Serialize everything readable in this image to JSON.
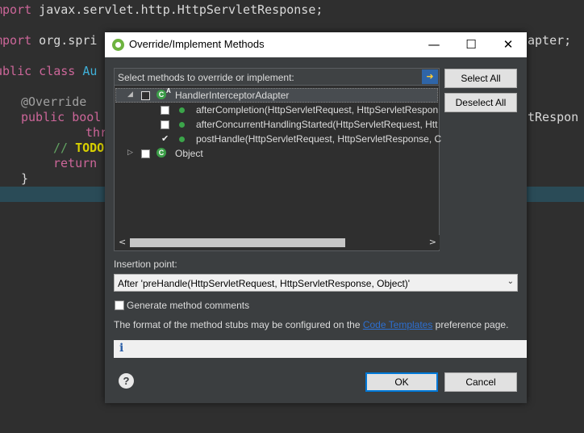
{
  "editor": {
    "lines": [
      {
        "a": "mport",
        "b": " javax.servlet.http.HttpServletResponse;"
      },
      {
        "a": "mport",
        "b": " org.spri"
      },
      {
        "a": "ublic class ",
        "b": "Au"
      },
      {
        "a": "@Override",
        "b": ""
      },
      {
        "a": "public bool",
        "b": ""
      },
      {
        "a": "thr",
        "b": ""
      },
      {
        "a": "// ",
        "b": "TODO"
      },
      {
        "a": "return ",
        "b": ""
      },
      {
        "a": "}",
        "b": ""
      }
    ],
    "right_fragments": [
      "apter;",
      "tRespon"
    ]
  },
  "dialog": {
    "title": "Override/Implement Methods",
    "window_buttons": {
      "minimize": "—",
      "maximize": "☐",
      "close": "✕"
    },
    "tree_header": "Select methods to override or implement:",
    "select_all": "Select All",
    "deselect_all": "Deselect All",
    "tree": {
      "root": {
        "label": "HandlerInterceptorAdapter",
        "icon_letter": "C",
        "abstract_mark": "A"
      },
      "methods": [
        {
          "label": "afterCompletion(HttpServletRequest, HttpServletRespon",
          "checked": false
        },
        {
          "label": "afterConcurrentHandlingStarted(HttpServletRequest, Htt",
          "checked": false
        },
        {
          "label": "postHandle(HttpServletRequest, HttpServletResponse, C",
          "checked": true
        }
      ],
      "second_root": {
        "label": "Object",
        "icon_letter": "C"
      }
    },
    "insertion_label": "Insertion point:",
    "insertion_value": "After 'preHandle(HttpServletRequest, HttpServletResponse, Object)'",
    "generate_comments": "Generate method comments",
    "stubs_text_before": "The format of the method stubs may be configured on the ",
    "stubs_link": "Code Templates",
    "stubs_text_after": " preference page.",
    "info_icon": "i",
    "help_icon": "?",
    "ok": "OK",
    "cancel": "Cancel"
  }
}
